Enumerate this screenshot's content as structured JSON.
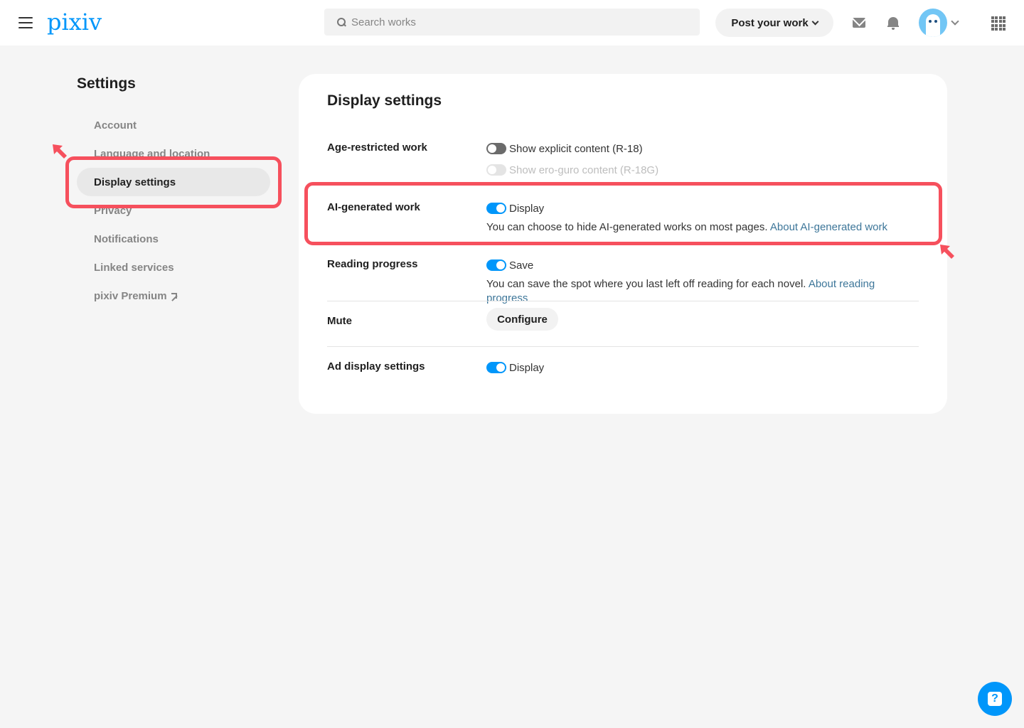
{
  "header": {
    "logo_text": "pixiv",
    "search_placeholder": "Search works",
    "post_button_label": "Post your work"
  },
  "sidebar": {
    "title": "Settings",
    "items": [
      {
        "label": "Account"
      },
      {
        "label": "Language and location"
      },
      {
        "label": "Display settings",
        "active": true
      },
      {
        "label": "Privacy"
      },
      {
        "label": "Notifications"
      },
      {
        "label": "Linked services"
      },
      {
        "label": "pixiv Premium",
        "external": true
      }
    ]
  },
  "main": {
    "title": "Display settings",
    "sections": {
      "age_restricted": {
        "label": "Age-restricted work",
        "options": [
          {
            "label": "Show explicit content (R-18)",
            "on": false,
            "disabled": false
          },
          {
            "label": "Show ero-guro content (R-18G)",
            "on": false,
            "disabled": true
          }
        ]
      },
      "ai_generated": {
        "label": "AI-generated work",
        "option_label": "Display",
        "on": true,
        "description": "You can choose to hide AI-generated works on most pages.",
        "link": "About AI-generated work"
      },
      "reading_progress": {
        "label": "Reading progress",
        "option_label": "Save",
        "on": true,
        "description": "You can save the spot where you last left off reading for each novel.",
        "link": "About reading progress"
      },
      "mute": {
        "label": "Mute",
        "button_label": "Configure"
      },
      "ads": {
        "label": "Ad display settings",
        "option_label": "Display",
        "on": true
      }
    }
  },
  "help_button": {
    "icon": "question-icon",
    "glyph": "?"
  },
  "colors": {
    "accent": "#0096fa",
    "highlight": "#f6505d",
    "link": "#3d7699"
  }
}
